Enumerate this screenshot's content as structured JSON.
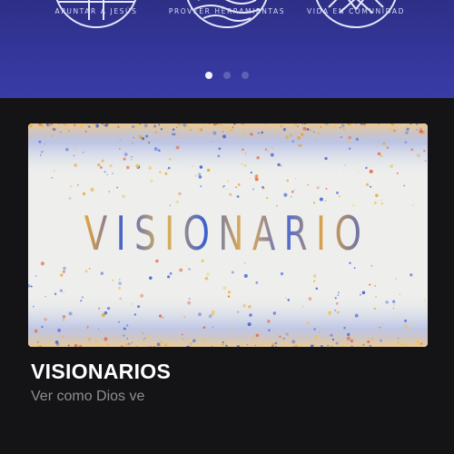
{
  "hero": {
    "pillars": [
      {
        "label": "APUNTAR A JESÚS",
        "icon": "cross-emblem-icon"
      },
      {
        "label": "PROVEER HERRAMIENTAS",
        "icon": "waves-emblem-icon"
      },
      {
        "label": "VIDA EN COMUNIDAD",
        "icon": "mountains-emblem-icon"
      }
    ],
    "carousel": {
      "total": 3,
      "active_index": 0
    }
  },
  "card": {
    "artwork_title": "VISIONARIOS",
    "title": "VISIONARIOS",
    "subtitle": "Ver como Dios ve"
  },
  "colors": {
    "hero_bg": "#34369a",
    "page_bg": "#141416",
    "accent_blue": "#3f5fd3",
    "accent_gold": "#e9a63a"
  }
}
